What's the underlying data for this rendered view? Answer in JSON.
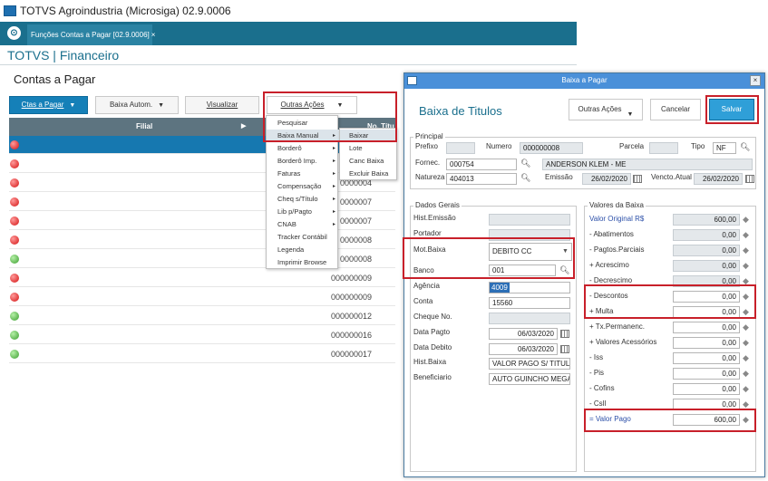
{
  "window": {
    "title": "TOTVS Agroindustria (Microsiga) 02.9.0006"
  },
  "tab": {
    "label": "Funções Contas a Pagar [02.9.0006]",
    "close": "×"
  },
  "module": {
    "title": "TOTVS | Financeiro"
  },
  "page": {
    "title": "Contas a Pagar"
  },
  "toolbar": {
    "ctas": "Ctas a Pagar",
    "baixa": "Baixa Autom.",
    "visualizar": "Visualizar",
    "outras": "Outras Ações"
  },
  "grid": {
    "headers": {
      "filial": "Filial",
      "titulo": "No. Títu"
    },
    "rows": [
      {
        "status": "red",
        "value": ""
      },
      {
        "status": "red",
        "value": ""
      },
      {
        "status": "red",
        "value": "0000004"
      },
      {
        "status": "red",
        "value": "0000007"
      },
      {
        "status": "red",
        "value": "0000007"
      },
      {
        "status": "red",
        "value": "0000008"
      },
      {
        "status": "green",
        "value": "0000008"
      },
      {
        "status": "red",
        "value": "000000009"
      },
      {
        "status": "red",
        "value": "000000009"
      },
      {
        "status": "green",
        "value": "000000012"
      },
      {
        "status": "green",
        "value": "000000016"
      },
      {
        "status": "green",
        "value": "000000017"
      }
    ]
  },
  "menu": {
    "items": [
      "Pesquisar",
      "Baixa Manual",
      "Borderô",
      "Borderô Imp.",
      "Faturas",
      "Compensação",
      "Cheq s/Título",
      "Lib p/Pagto",
      "CNAB",
      "Tracker Contábil",
      "Legenda",
      "Imprimir Browse"
    ],
    "submenu_arrow": "▸",
    "sub": [
      "Baixar",
      "Lote",
      "Canc Baixa",
      "Excluir Baixa"
    ]
  },
  "dialog": {
    "bar_title": "Baixa a Pagar",
    "close": "×",
    "title": "Baixa de Titulos",
    "buttons": {
      "outras": "Outras Ações",
      "cancelar": "Cancelar",
      "salvar": "Salvar"
    },
    "principal": {
      "legend": "Principal",
      "prefixo": "Prefixo",
      "numero": "Numero",
      "numero_val": "000000008",
      "parcela": "Parcela",
      "tipo": "Tipo",
      "tipo_val": "NF",
      "fornec": "Fornec.",
      "fornec_val": "000754",
      "fornec_nome": "ANDERSON KLEM - ME",
      "natureza": "Natureza",
      "natureza_val": "404013",
      "emissao": "Emissão",
      "emissao_val": "26/02/2020",
      "vencto": "Vencto.Atual",
      "vencto_val": "26/02/2020"
    },
    "gerais": {
      "legend": "Dados Gerais",
      "hist_emissao": "Hist.Emissão",
      "portador": "Portador",
      "mot_baixa": "Mot.Baixa",
      "mot_baixa_val": "DEBITO CC",
      "banco": "Banco",
      "banco_val": "001",
      "agencia": "Agência",
      "agencia_val": "4009",
      "conta": "Conta",
      "conta_val": "15560",
      "cheque": "Cheque No.",
      "data_pagto": "Data Pagto",
      "data_pagto_val": "06/03/2020",
      "data_debito": "Data Debito",
      "data_debito_val": "06/03/2020",
      "hist_baixa": "Hist.Baixa",
      "hist_baixa_val": "VALOR PAGO S/ TITULO",
      "beneficiario": "Beneficiario",
      "beneficiario_val": "AUTO GUINCHO MEGA"
    },
    "valores": {
      "legend": "Valores da Baixa",
      "items": [
        {
          "label": "Valor Original R$",
          "value": "600,00"
        },
        {
          "label": "- Abatimentos",
          "value": "0,00"
        },
        {
          "label": "- Pagtos.Parciais",
          "value": "0,00"
        },
        {
          "label": "+ Acrescimo",
          "value": "0,00"
        },
        {
          "label": "- Decrescimo",
          "value": "0,00"
        },
        {
          "label": "- Descontos",
          "value": "0,00"
        },
        {
          "label": "+ Multa",
          "value": "0,00"
        },
        {
          "label": "+ Tx.Permanenc.",
          "value": "0,00"
        },
        {
          "label": "+ Valores Acessórios",
          "value": "0,00"
        },
        {
          "label": "- Iss",
          "value": "0,00"
        },
        {
          "label": "- Pis",
          "value": "0,00"
        },
        {
          "label": "- Cofins",
          "value": "0,00"
        },
        {
          "label": "- Csll",
          "value": "0,00"
        },
        {
          "label": "= Valor Pago",
          "value": "600,00"
        }
      ]
    }
  },
  "colors": {
    "accent": "#1a6f8d",
    "highlight": "#c8202a",
    "select": "#1678b0"
  }
}
